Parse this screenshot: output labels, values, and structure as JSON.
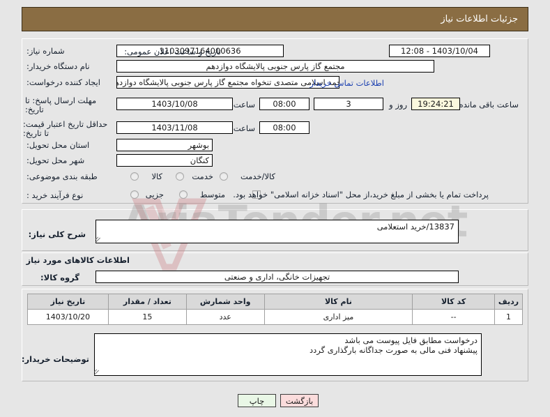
{
  "window": {
    "title": "جزئیات اطلاعات نیاز"
  },
  "colors": {
    "header_bg": "#8a6d43",
    "header_text": "#ffffff",
    "page_bg": "#e6e6e6",
    "link": "#1a3fb0",
    "countdown_bg": "#fbf8dd",
    "print_btn_bg": "#e9f7e6",
    "back_btn_bg": "#fbdcdc",
    "table_header_bg": "#d9d9d9"
  },
  "watermark": {
    "text": "AriaTender.net"
  },
  "form": {
    "need_number_label": "شماره نیاز:",
    "need_number_value": "1103097164000636",
    "announce_datetime_label": "تاریخ و ساعت اعلان عمومی:",
    "announce_datetime_value": "1403/10/04 - 12:08",
    "buyer_org_label": "نام دستگاه خریدار:",
    "buyer_org_value": "مجتمع گاز پارس جنوبی  پالایشگاه دوازدهم",
    "requester_label": "ایجاد کننده درخواست:",
    "requester_value": "محمد اسلامی متصدی تنخواه مجتمع گاز پارس جنوبی  پالایشگاه دوازدهم",
    "buyer_contact_link": "اطلاعات تماس خریدار",
    "response_deadline_label": "مهلت ارسال پاسخ: تا تاریخ:",
    "response_deadline_date": "1403/10/08",
    "response_deadline_hour_label": "ساعت",
    "response_deadline_time": "08:00",
    "remaining_days": "3",
    "remaining_days_label": "روز و",
    "remaining_time": "19:24:21",
    "remaining_time_label": "ساعت باقی مانده",
    "price_validity_label": "حداقل تاریخ اعتبار قیمت: تا تاریخ:",
    "price_validity_date": "1403/11/08",
    "price_validity_hour_label": "ساعت",
    "price_validity_time": "08:00",
    "delivery_province_label": "استان محل تحویل:",
    "delivery_province_value": "بوشهر",
    "delivery_city_label": "شهر محل تحویل:",
    "delivery_city_value": "کنگان",
    "category_label": "طبقه بندی موضوعی:",
    "category_options": [
      {
        "label": "کالا",
        "selected": false
      },
      {
        "label": "خدمت",
        "selected": false
      },
      {
        "label": "کالا/خدمت",
        "selected": false
      }
    ],
    "process_type_label": "نوع فرآیند خرید :",
    "process_type_options": [
      {
        "label": "جزیی",
        "selected": false
      },
      {
        "label": "متوسط",
        "selected": false
      }
    ],
    "islamic_treasury_checkbox_label": "پرداخت تمام یا بخشی از مبلغ خرید،از محل \"اسناد خزانه اسلامی\" خواهد بود.",
    "islamic_treasury_checked": false
  },
  "summary": {
    "label": "شرح کلی نیاز:",
    "value": "13837/خرید استعلامی"
  },
  "goods_section": {
    "heading": "اطلاعات کالاهای مورد نیاز",
    "group_label": "گروه کالا:",
    "group_value": "تجهیزات خانگی، اداری و صنعتی"
  },
  "table": {
    "headers": [
      "ردیف",
      "کد کالا",
      "نام کالا",
      "واحد شمارش",
      "تعداد / مقدار",
      "تاریخ نیاز"
    ],
    "rows": [
      {
        "row": "1",
        "code": "--",
        "name": "میز اداری",
        "unit": "عدد",
        "qty": "15",
        "need_date": "1403/10/20"
      }
    ]
  },
  "buyer_notes": {
    "label": "توضیحات خریدار:",
    "value": "درخواست مطابق فایل پیوست می باشد\nپیشنهاد فنی مالی به صورت جداگانه بارگذاری گردد"
  },
  "buttons": {
    "print": "چاپ",
    "back": "بازگشت"
  }
}
